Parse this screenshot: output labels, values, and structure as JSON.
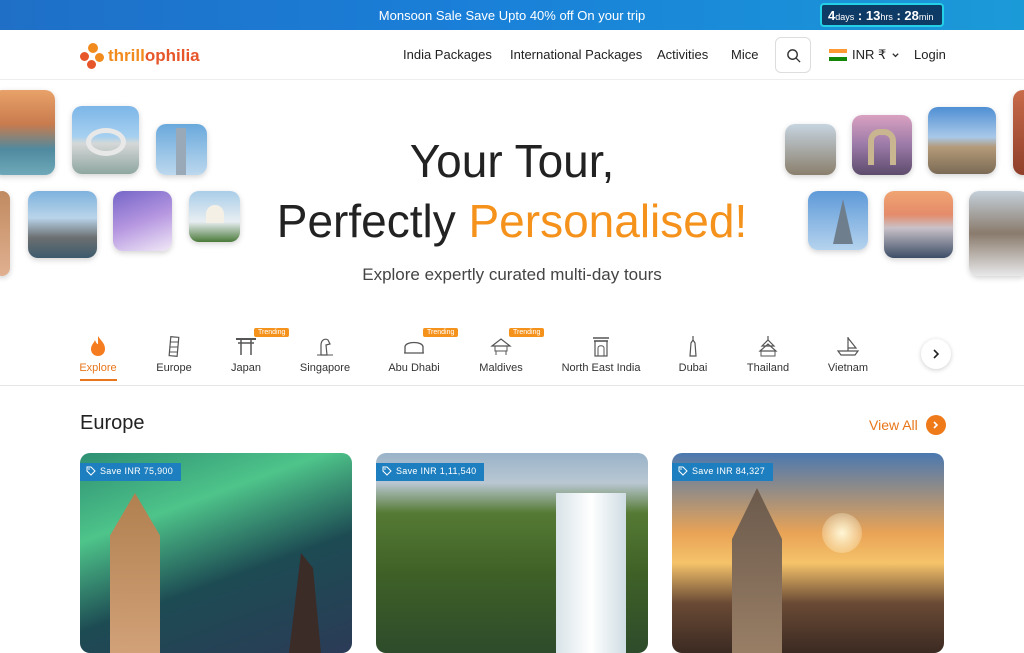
{
  "banner": {
    "text": "Monsoon Sale Save Upto 40% off On your trip",
    "timer": {
      "days": "4",
      "days_unit": "days",
      "hrs": "13",
      "hrs_unit": "hrs",
      "min": "28",
      "min_unit": "min",
      "sep": ":"
    }
  },
  "header": {
    "logo": {
      "part1": "thrill",
      "part2": "ophilia"
    },
    "nav": [
      "India Packages",
      "International Packages",
      "Activities",
      "Mice"
    ],
    "currency": "INR ₹",
    "login": "Login"
  },
  "hero": {
    "title_line1": "Your Tour,",
    "title_line2_plain": "Perfectly",
    "title_line2_accent": "Personalised!",
    "subtitle": "Explore expertly curated multi-day tours"
  },
  "categories": [
    {
      "label": "Explore",
      "icon": "fire-icon",
      "active": true
    },
    {
      "label": "Europe",
      "icon": "leaning-tower-icon"
    },
    {
      "label": "Japan",
      "icon": "torii-gate-icon",
      "badge": "Trending"
    },
    {
      "label": "Singapore",
      "icon": "merlion-icon"
    },
    {
      "label": "Abu Dhabi",
      "icon": "dome-icon",
      "badge": "Trending"
    },
    {
      "label": "Maldives",
      "icon": "hut-icon",
      "badge": "Trending"
    },
    {
      "label": "North East India",
      "icon": "gate-icon"
    },
    {
      "label": "Dubai",
      "icon": "tower-icon"
    },
    {
      "label": "Thailand",
      "icon": "temple-icon"
    },
    {
      "label": "Vietnam",
      "icon": "boat-icon"
    }
  ],
  "section": {
    "title": "Europe",
    "view_all": "View All",
    "cards": [
      {
        "save": "Save INR 75,900"
      },
      {
        "save": "Save INR 1,11,540"
      },
      {
        "save": "Save INR 84,327"
      }
    ]
  },
  "colors": {
    "accent": "#f5921b",
    "banner": "#1f7fd0",
    "badge": "#1d7fbf"
  }
}
